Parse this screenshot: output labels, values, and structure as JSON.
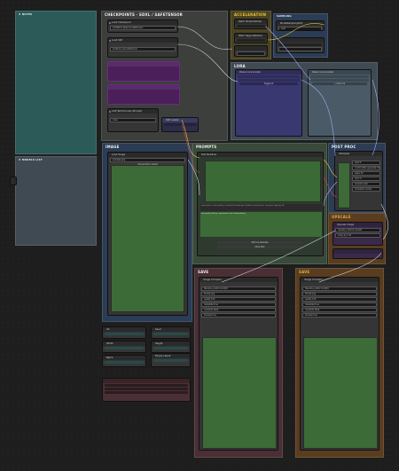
{
  "groups": {
    "checkpoints": "CHECKPOINTS · SDXL / SAFETENSOR",
    "acceleration": "ACCELERATION",
    "lora": "LORA",
    "image": "IMAGE",
    "prompts": "PROMPTS",
    "post_proc": "POST PROC",
    "upscale": "UPSCALE",
    "save_left": "SAVE",
    "save_right": "SAVE"
  },
  "notes": {
    "left_top": "# NOTES",
    "left_mid": "# MODELS LIST"
  },
  "checkpoint_nodes": {
    "loader_a_title": "Load Checkpoint",
    "loader_a_value": "sdxl/SDXL_Base1.0.safetensors",
    "loader_b_title": "Load VAE",
    "loader_b_value": "sdxl/sdxl_vae.safetensors",
    "clip_title": "CLIP Text Encode (Prompt)",
    "clip_value": "none",
    "vae_title": "VAE Loader"
  },
  "accel_nodes": {
    "a_title": "Patch Model Patcher",
    "b_title": "Patch Sage Attention",
    "c_title": "ModelSamplingSD3",
    "c_value": "auto"
  },
  "lora_nodes": {
    "left_title": "Power Lora Loader",
    "right_title": "Power Lora Loader",
    "add_label": "+ Add Lora",
    "toggle_label": "Toggle All"
  },
  "image_nodes": {
    "load_title": "Load Image",
    "file_value": "example.png",
    "upload_label": "choose file to upload"
  },
  "prompts": {
    "node_title": "Text Multiline",
    "text_preview": "masterpiece, best quality, a beautiful landscape, detailed, sharp focus, cinematic lighting, 8k",
    "negative_preview": "low quality, blurry, watermark, text, bad anatomy",
    "btn_a": "Text Concatenate",
    "btn_b": "Show Text"
  },
  "post_proc": {
    "title": "KSampler",
    "rows": [
      "seed 0",
      "control after generate: fixed",
      "steps 30",
      "cfg 7.0",
      "sampler euler",
      "scheduler normal",
      "denoise 1.00"
    ]
  },
  "upscale": {
    "title": "Upscale Image",
    "rows": [
      "upscale_method nearest",
      "scale_by 1.50"
    ]
  },
  "save": {
    "left_title": "Image Compare",
    "right_title": "Image Compare",
    "rows": [
      "filename_prefix ComfyUI",
      "format png",
      "quality 100",
      "metadata true",
      "overwrite false",
      "preview true"
    ]
  },
  "misc_nodes": {
    "a": "Int",
    "b": "Seed",
    "c": "Width",
    "d": "Height",
    "e": "Batch",
    "f": "Empty Latent"
  },
  "colors": {
    "group_teal": "#2c5a58",
    "group_slate": "#3f4a52",
    "group_blue": "#2b3d55",
    "group_brown": "#5a3d1f",
    "group_maroon": "#4a2f34",
    "preview_green": "#3c6b37"
  }
}
